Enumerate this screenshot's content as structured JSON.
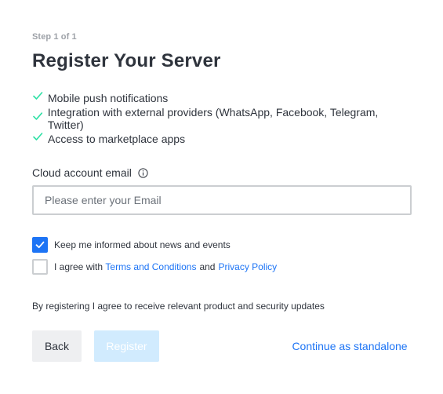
{
  "header": {
    "step": "Step 1 of 1",
    "title": "Register Your Server"
  },
  "features": [
    {
      "icon": "check-icon",
      "label": "Mobile push notifications"
    },
    {
      "icon": "check-icon",
      "label": "Integration with external providers (WhatsApp, Facebook, Telegram, Twitter)"
    },
    {
      "icon": "check-icon",
      "label": "Access to marketplace apps"
    }
  ],
  "email": {
    "label": "Cloud account email",
    "info_icon": "info-icon",
    "value": "",
    "placeholder": "Please enter your Email"
  },
  "checkboxes": {
    "news": {
      "checked": true,
      "label": "Keep me informed about news and events"
    },
    "terms": {
      "checked": false,
      "prefix": "I agree with",
      "terms_link": "Terms and Conditions",
      "and": "and",
      "privacy_link": "Privacy Policy"
    }
  },
  "disclaimer": "By registering I agree to receive relevant product and security updates",
  "actions": {
    "back": "Back",
    "register": "Register",
    "standalone": "Continue as standalone"
  },
  "colors": {
    "accent": "#1d74f5",
    "check": "#2de0a5",
    "register_disabled_bg": "#d1ebfe"
  }
}
